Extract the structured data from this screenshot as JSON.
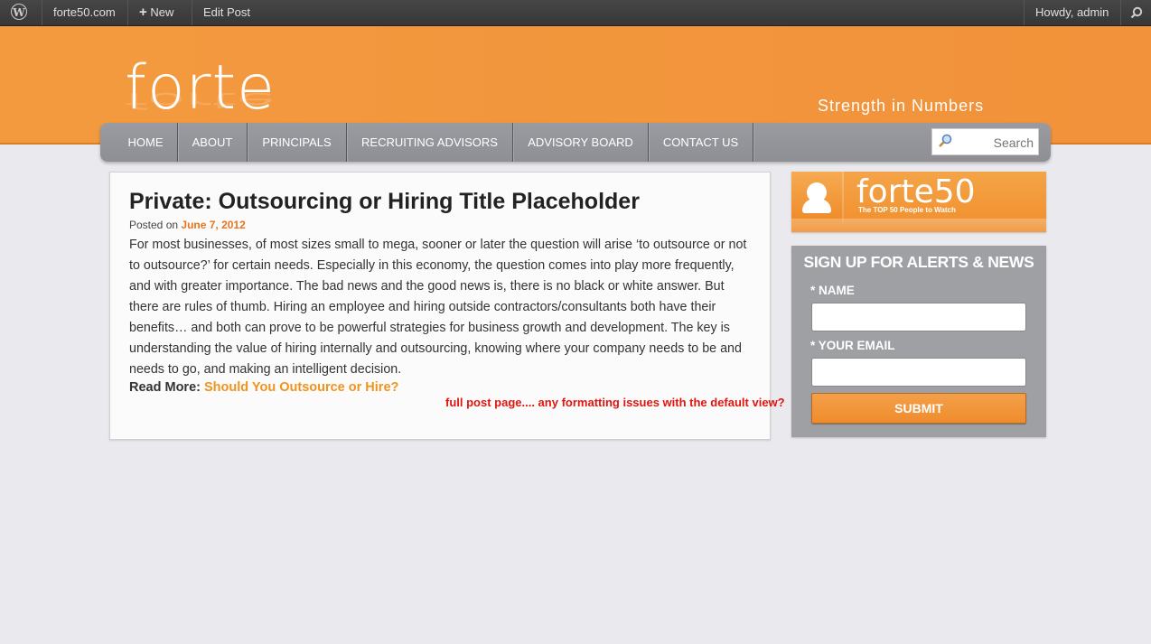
{
  "adminbar": {
    "site": "forte50.com",
    "new": "New",
    "edit": "Edit Post",
    "howdy": "Howdy, admin"
  },
  "header": {
    "logo": "forte",
    "tagline": "Strength in Numbers"
  },
  "nav": {
    "items": [
      "HOME",
      "ABOUT",
      "PRINCIPALS",
      "RECRUITING ADVISORS",
      "ADVISORY BOARD",
      "CONTACT US"
    ],
    "search_placeholder": "Search"
  },
  "post": {
    "title": "Private: Outsourcing or Hiring Title Placeholder",
    "posted_on": "Posted on",
    "date": "June 7, 2012",
    "body": "For most businesses, of most sizes small to mega, sooner or later the question will arise ‘to outsource or not to outsource?’ for certain needs. Especially in this economy, the question comes into play more frequently, and with greater importance. The bad news and the good news is, there is no black or white answer. But there are rules of thumb. Hiring an employee and hiring outside contractors/consultants both have their benefits… and both can prove to be powerful strategies for business growth and development. The key is understanding the value of hiring internally and outsourcing, knowing where your company needs to be and needs to go, and making an intelligent decision.",
    "read_more_label": "Read More:",
    "read_more_link": "Should You Outsource or Hire?"
  },
  "annotation": "full post page.... any formatting issues with the default view?",
  "banner": {
    "title": "forte50",
    "subtitle": "The TOP 50 People to Watch"
  },
  "signup": {
    "heading": "SIGN UP FOR ALERTS & NEWS",
    "name_label": "* NAME",
    "email_label": "* YOUR EMAIL",
    "submit": "SUBMIT"
  }
}
